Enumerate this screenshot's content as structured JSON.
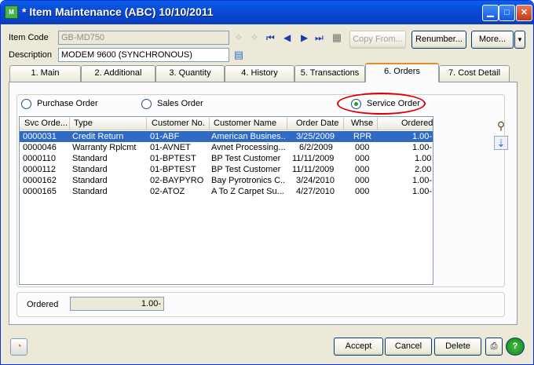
{
  "window": {
    "title": "* Item Maintenance (ABC) 10/10/2011",
    "icon_name": "app-icon",
    "controls": [
      "minimize",
      "maximize",
      "close"
    ]
  },
  "header": {
    "item_code_label": "Item Code",
    "item_code_value": "GB-MD750",
    "description_label": "Description",
    "description_value": "MODEM 9600 (SYNCHRONOUS)",
    "buttons": {
      "copy_from": "Copy From...",
      "renumber": "Renumber...",
      "more": "More..."
    }
  },
  "tabs": [
    {
      "label": "1. Main"
    },
    {
      "label": "2. Additional"
    },
    {
      "label": "3. Quantity"
    },
    {
      "label": "4. History"
    },
    {
      "label": "5. Transactions"
    },
    {
      "label": "6. Orders"
    },
    {
      "label": "7. Cost Detail"
    }
  ],
  "active_tab": "6. Orders",
  "order_type": {
    "options": [
      "Purchase Order",
      "Sales Order",
      "Service Order"
    ],
    "selected": "Service Order"
  },
  "grid": {
    "columns": [
      "Svc Orde...",
      "Type",
      "Customer No.",
      "Customer Name",
      "Order Date",
      "Whse",
      "Ordered"
    ],
    "rows": [
      [
        "0000031",
        "Credit Return",
        "01-ABF",
        "American Busines...",
        "3/25/2009",
        "RPR",
        "1.00-"
      ],
      [
        "0000046",
        "Warranty Rplcmt",
        "01-AVNET",
        "Avnet Processing...",
        "6/2/2009",
        "000",
        "1.00-"
      ],
      [
        "0000110",
        "Standard",
        "01-BPTEST",
        "BP Test Customer",
        "11/11/2009",
        "000",
        "1.00"
      ],
      [
        "0000112",
        "Standard",
        "01-BPTEST",
        "BP Test Customer",
        "11/11/2009",
        "000",
        "2.00"
      ],
      [
        "0000162",
        "Standard",
        "02-BAYPYRO",
        "Bay Pyrotronics C...",
        "3/24/2010",
        "000",
        "1.00-"
      ],
      [
        "0000165",
        "Standard",
        "02-ATOZ",
        "A To Z Carpet Su...",
        "4/27/2010",
        "000",
        "1.00-"
      ]
    ],
    "selected_row": 0
  },
  "totals": {
    "ordered_label": "Ordered",
    "ordered_value": "1.00-"
  },
  "footer": {
    "accept": "Accept",
    "cancel": "Cancel",
    "delete": "Delete"
  },
  "colors": {
    "title_bar": "#0a5fe8",
    "selection": "#316ac5",
    "annotation_circle": "#e00000",
    "active_tab_accent": "#e68b2c"
  }
}
